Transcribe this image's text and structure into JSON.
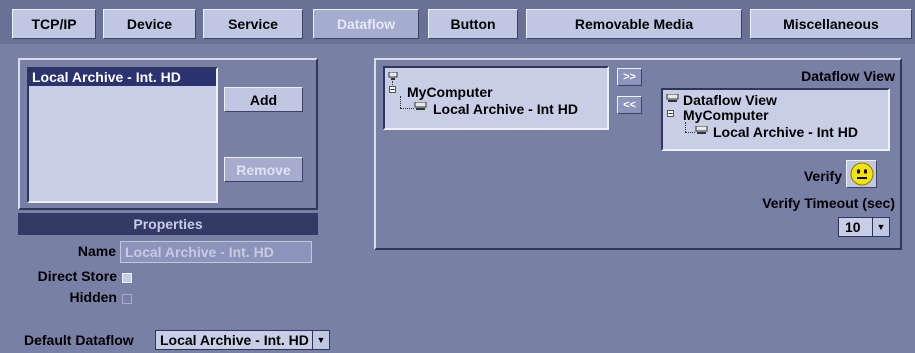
{
  "tabs": [
    {
      "label": "TCP/IP",
      "active": false
    },
    {
      "label": "Device",
      "active": false
    },
    {
      "label": "Service",
      "active": false
    },
    {
      "label": "Dataflow",
      "active": true
    },
    {
      "label": "Button",
      "active": false
    },
    {
      "label": "Removable Media",
      "active": false
    },
    {
      "label": "Miscellaneous",
      "active": false
    }
  ],
  "dataflow_list": {
    "items": [
      "Local Archive - Int. HD"
    ],
    "selected_index": 0,
    "add_label": "Add",
    "remove_label": "Remove"
  },
  "properties": {
    "header": "Properties",
    "name_label": "Name",
    "name_value": "Local Archive - Int. HD",
    "direct_store_label": "Direct Store",
    "direct_store_checked": false,
    "hidden_label": "Hidden",
    "hidden_checked": false
  },
  "default_dataflow": {
    "label": "Default Dataflow",
    "value": "Local Archive - Int. HD"
  },
  "device_tree": {
    "root": "MyComputer",
    "child": "Local Archive - Int HD"
  },
  "move_buttons": {
    "right": ">>",
    "left": "<<"
  },
  "dataflow_view": {
    "title": "Dataflow View",
    "tree_root": "Dataflow View",
    "tree_node": "MyComputer",
    "tree_leaf": "Local Archive - Int HD"
  },
  "verify": {
    "label": "Verify",
    "timeout_label": "Verify Timeout (sec)",
    "timeout_value": "10"
  },
  "colors": {
    "background": "#7880a6",
    "tab_bg": "#c0c7e3",
    "selection": "#2b3270",
    "smiley": "#f5e400"
  }
}
